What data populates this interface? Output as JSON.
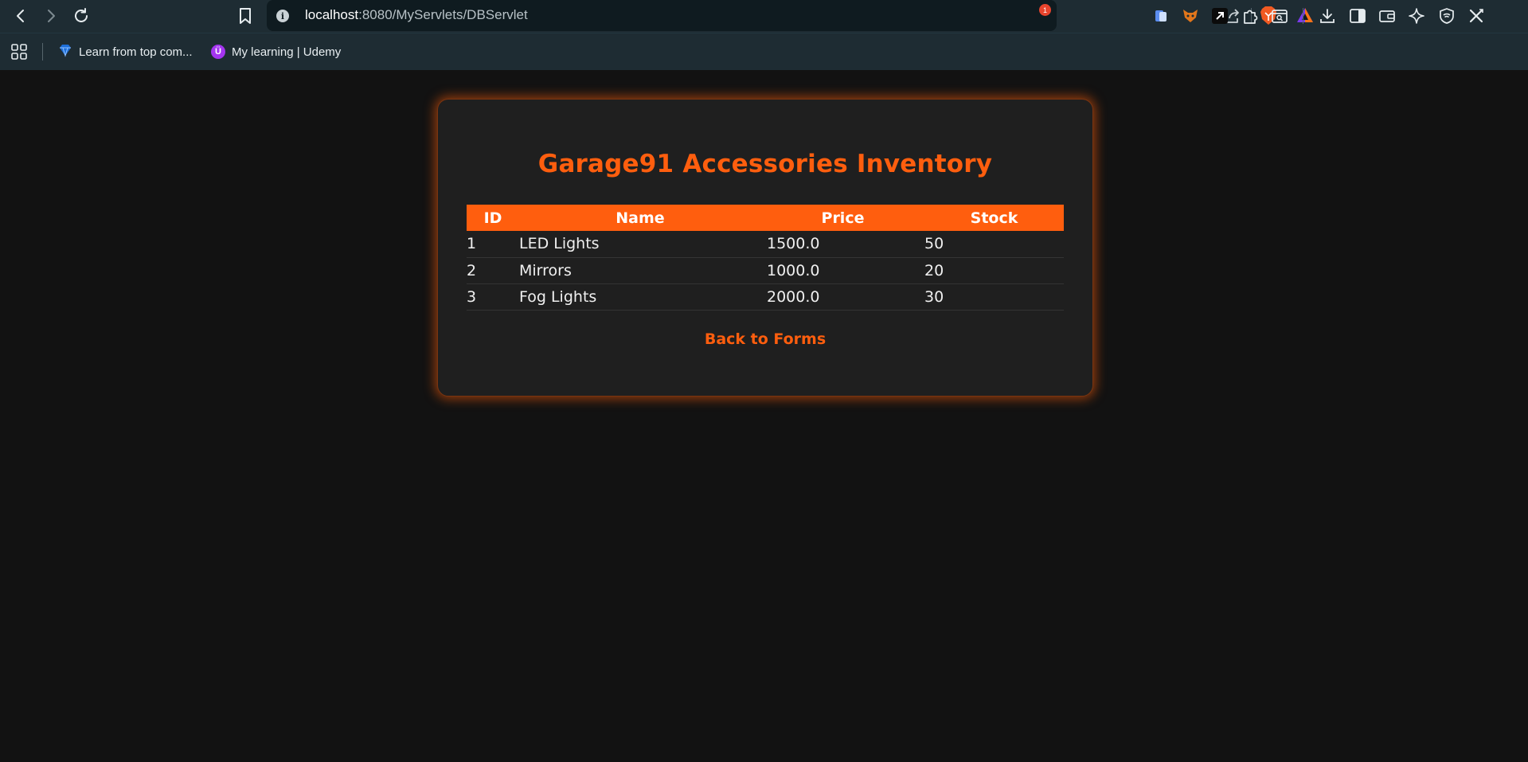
{
  "browser": {
    "url_host": "localhost",
    "url_rest": ":8080/MyServlets/DBServlet",
    "rewards_badge": "1",
    "icons": [
      "back-icon",
      "forward-icon",
      "reload-icon",
      "bookmark-icon",
      "site-info-icon",
      "share-icon",
      "brave-shields-icon",
      "brave-rewards-icon",
      "extension-icon-1",
      "extension-icon-2",
      "extension-icon-3",
      "extensions-puzzle-icon",
      "search-tab-icon",
      "download-icon",
      "sidebar-icon",
      "wallet-icon",
      "leo-ai-icon",
      "vpn-icon",
      "x-icon"
    ]
  },
  "bookmarks": [
    {
      "label": "Learn from top com...",
      "icon": "diamond-icon",
      "color": "#1e6fd9"
    },
    {
      "label": "My learning | Udemy",
      "icon": "udemy-icon",
      "color": "#a435f0"
    }
  ],
  "page": {
    "title": "Garage91 Accessories Inventory",
    "accent_color": "#ff5e0e",
    "table": {
      "headers": [
        "ID",
        "Name",
        "Price",
        "Stock"
      ],
      "rows": [
        [
          "1",
          "LED Lights",
          "1500.0",
          "50"
        ],
        [
          "2",
          "Mirrors",
          "1000.0",
          "20"
        ],
        [
          "3",
          "Fog Lights",
          "2000.0",
          "30"
        ]
      ]
    },
    "back_link": "Back to Forms"
  }
}
